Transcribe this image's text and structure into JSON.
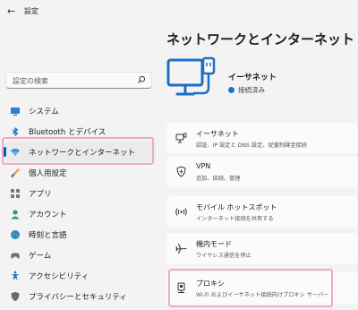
{
  "window": {
    "back_glyph": "←",
    "title": "設定"
  },
  "search": {
    "placeholder": "設定の検索",
    "icon": "search-icon"
  },
  "nav": {
    "items": [
      {
        "label": "システム",
        "icon": "monitor-icon"
      },
      {
        "label": "Bluetooth とデバイス",
        "icon": "bluetooth-icon"
      },
      {
        "label": "ネットワークとインターネット",
        "icon": "wifi-icon",
        "selected": true
      },
      {
        "label": "個人用設定",
        "icon": "brush-icon"
      },
      {
        "label": "アプリ",
        "icon": "apps-icon"
      },
      {
        "label": "アカウント",
        "icon": "account-icon"
      },
      {
        "label": "時刻と言語",
        "icon": "globe-icon"
      },
      {
        "label": "ゲーム",
        "icon": "gamepad-icon"
      },
      {
        "label": "アクセシビリティ",
        "icon": "accessibility-icon"
      },
      {
        "label": "プライバシーとセキュリティ",
        "icon": "shield-icon"
      }
    ]
  },
  "main": {
    "title": "ネットワークとインターネット",
    "hero": {
      "name": "イーサネット",
      "status": "接続済み"
    },
    "cards": [
      {
        "title": "イーサネット",
        "subtitle": "認証、IP 設定と DNS 設定、従量制課金接続",
        "icon": "ethernet-icon"
      },
      {
        "title": "VPN",
        "subtitle": "追加、接続、管理",
        "icon": "vpn-shield-icon"
      },
      {
        "title": "モバイル ホットスポット",
        "subtitle": "インターネット接続を共有する",
        "icon": "hotspot-icon"
      },
      {
        "title": "機内モード",
        "subtitle": "ワイヤレス通信を停止",
        "icon": "airplane-icon"
      },
      {
        "title": "プロキシ",
        "subtitle": "Wi-Fi およびイーサネット接続向けプロキシ サーバー",
        "icon": "proxy-icon"
      }
    ]
  },
  "colors": {
    "accent": "#005fb8",
    "highlight": "#f0a9c4",
    "status_dot": "#1778c8"
  }
}
